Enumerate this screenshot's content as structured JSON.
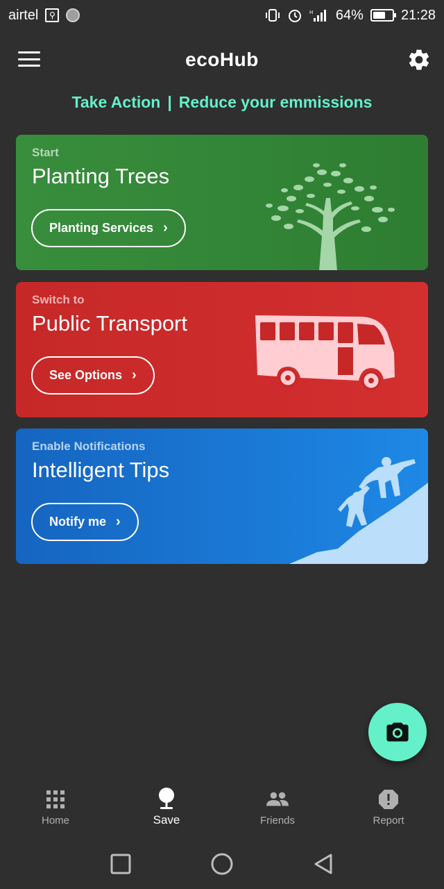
{
  "status_bar": {
    "carrier": "airtel",
    "battery_percent": "64%",
    "battery_level": 0.64,
    "time": "21:28",
    "icons": [
      "usb-icon",
      "notification-dot-icon",
      "vibrate-icon",
      "alarm-icon",
      "signal-icon",
      "battery-icon"
    ]
  },
  "app_bar": {
    "title": "ecoHub",
    "menu_icon": "hamburger-menu-icon",
    "settings_icon": "gear-icon"
  },
  "tagline": {
    "left": "Take Action",
    "separator": "|",
    "right": "Reduce your emmissions",
    "color": "#64f0c8"
  },
  "cards": [
    {
      "eyebrow": "Start",
      "title": "Planting Trees",
      "button_label": "Planting Services",
      "chevron": "›",
      "color": "#2e7d32",
      "art_icon": "tree-icon"
    },
    {
      "eyebrow": "Switch to",
      "title": "Public Transport",
      "button_label": "See Options",
      "chevron": "›",
      "color": "#d32f2f",
      "art_icon": "bus-icon"
    },
    {
      "eyebrow": "Enable Notifications",
      "title": "Intelligent Tips",
      "button_label": "Notify me",
      "chevron": "›",
      "color": "#1e88e5",
      "art_icon": "climbers-helping-icon"
    }
  ],
  "fab": {
    "icon": "camera-icon",
    "color": "#64f0c8"
  },
  "bottom_nav": [
    {
      "label": "Home",
      "icon": "grid-icon",
      "active": false
    },
    {
      "label": "Save",
      "icon": "tree-small-icon",
      "active": true
    },
    {
      "label": "Friends",
      "icon": "people-icon",
      "active": false
    },
    {
      "label": "Report",
      "icon": "alert-octagon-icon",
      "active": false
    }
  ],
  "system_nav": [
    "recents-square-icon",
    "home-circle-icon",
    "back-triangle-icon"
  ]
}
